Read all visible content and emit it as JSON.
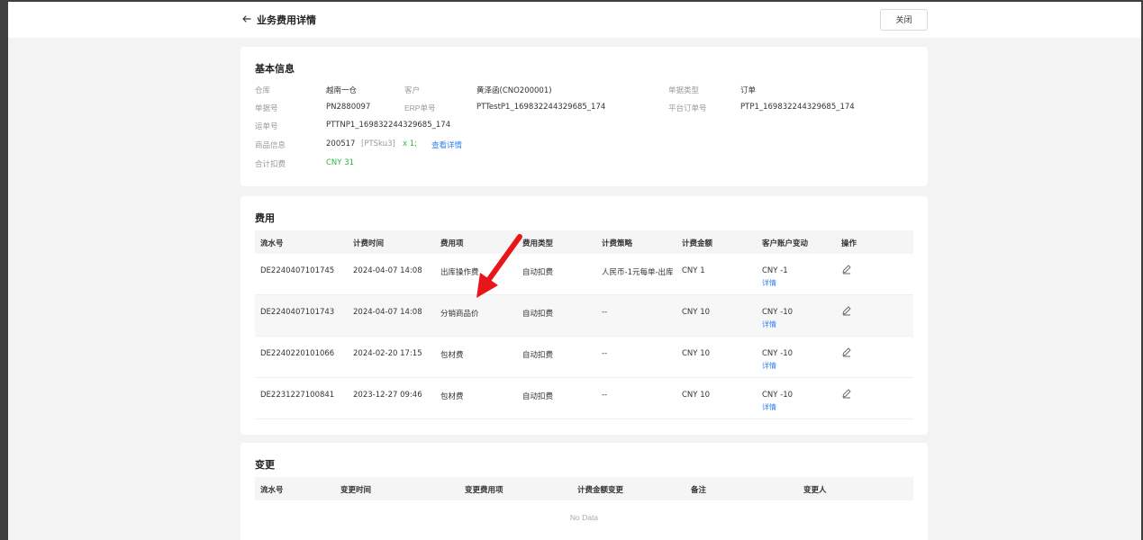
{
  "header": {
    "title": "业务费用详情",
    "close_label": "关闭"
  },
  "basic_info": {
    "section_title": "基本信息",
    "warehouse_label": "仓库",
    "warehouse": "越南一仓",
    "customer_label": "客户",
    "customer": "黄泽函(CNO200001)",
    "doc_type_label": "单据类型",
    "doc_type": "订单",
    "doc_no_label": "单据号",
    "doc_no": "PN2880097",
    "erp_no_label": "ERP单号",
    "erp_no": "PTTestP1_169832244329685_174",
    "platform_no_label": "平台订单号",
    "platform_no": "PTP1_169832244329685_174",
    "tracking_no_label": "运单号",
    "tracking_no": "PTTNP1_169832244329685_174",
    "goods_label": "商品信息",
    "goods_id": "200517",
    "goods_sku": "[PTSku3]",
    "goods_qty": "x 1;",
    "goods_link": "查看详情",
    "total_label": "合计扣费",
    "total": "CNY 31"
  },
  "fees": {
    "section_title": "费用",
    "columns": [
      "流水号",
      "计费时间",
      "费用项",
      "费用类型",
      "计费策略",
      "计费金额",
      "客户账户变动",
      "操作"
    ],
    "rows": [
      {
        "serial": "DE2240407101745",
        "time": "2024-04-07 14:08",
        "item": "出库操作费",
        "type": "自动扣费",
        "strategy": "人民币-1元每单-出库",
        "amount": "CNY 1",
        "change": "CNY -1",
        "detail": "详情"
      },
      {
        "serial": "DE2240407101743",
        "time": "2024-04-07 14:08",
        "item": "分销商品价",
        "type": "自动扣费",
        "strategy": "--",
        "amount": "CNY 10",
        "change": "CNY -10",
        "detail": "详情"
      },
      {
        "serial": "DE2240220101066",
        "time": "2024-02-20 17:15",
        "item": "包材费",
        "type": "自动扣费",
        "strategy": "--",
        "amount": "CNY 10",
        "change": "CNY -10",
        "detail": "详情"
      },
      {
        "serial": "DE2231227100841",
        "time": "2023-12-27 09:46",
        "item": "包材费",
        "type": "自动扣费",
        "strategy": "--",
        "amount": "CNY 10",
        "change": "CNY -10",
        "detail": "详情"
      }
    ]
  },
  "changes": {
    "section_title": "变更",
    "columns": [
      "流水号",
      "变更时间",
      "变更费用项",
      "计费金额变更",
      "备注",
      "变更人"
    ],
    "empty_text": "No Data"
  },
  "colors": {
    "accent": "#2f80ed",
    "success": "#2fb344",
    "annotation_arrow": "#e8161b"
  }
}
